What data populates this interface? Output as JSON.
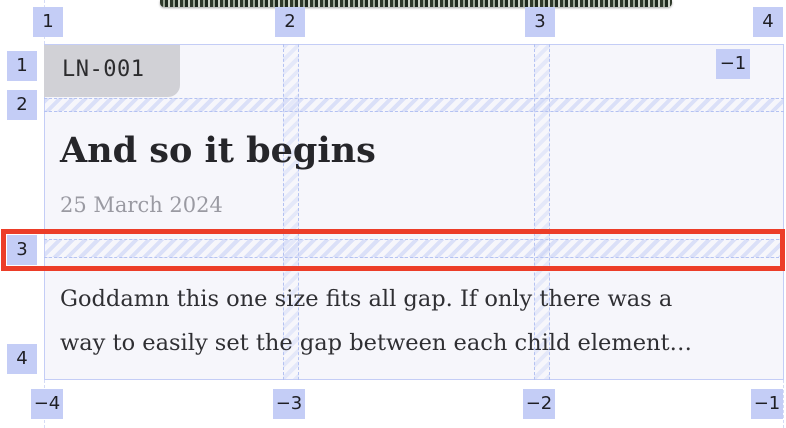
{
  "card": {
    "tag": "LN-001",
    "title": "And so it begins",
    "date": "25 March 2024",
    "body_lines": [
      "Goddamn this one size fits all gap. If only there was a",
      "way to easily set the gap between each child element…"
    ]
  },
  "grid_overlay": {
    "column_labels_top": [
      "1",
      "2",
      "3",
      "4"
    ],
    "column_labels_bottom": [
      "−4",
      "−3",
      "−2",
      "−1"
    ],
    "row_labels_left": [
      "1",
      "2",
      "3",
      "4"
    ],
    "row_label_right_top": "−1",
    "highlighted_row_gap": "3",
    "colors": {
      "overlay": "#c4cdf6",
      "highlight": "#ec3d28"
    }
  }
}
